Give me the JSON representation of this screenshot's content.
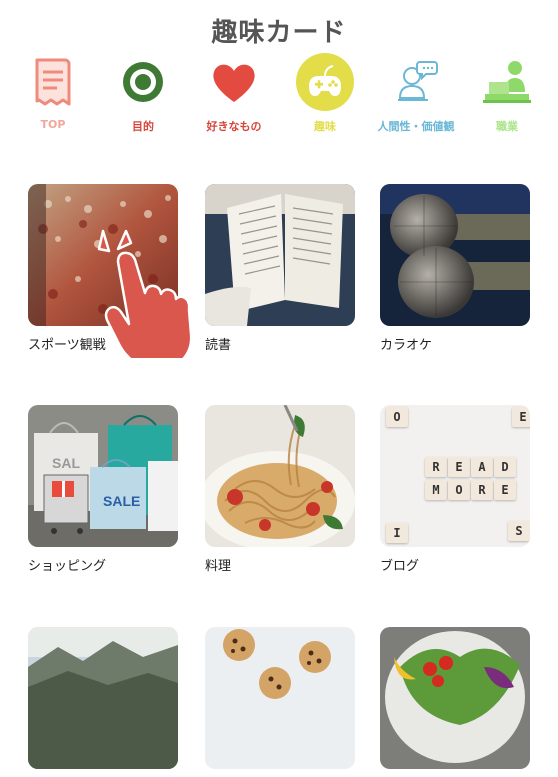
{
  "page_title": "趣味カード",
  "tabs": [
    {
      "label": "TOP",
      "icon": "document-icon",
      "color": "#f4a69a"
    },
    {
      "label": "目的",
      "icon": "target-icon",
      "color": "#d6453a"
    },
    {
      "label": "好きなもの",
      "icon": "heart-icon",
      "color": "#d6453a"
    },
    {
      "label": "趣味",
      "icon": "gamepad-icon",
      "color": "#e2dd49",
      "active": true
    },
    {
      "label": "人間性・価値観",
      "icon": "person-chat-icon",
      "color": "#6ab7d6"
    },
    {
      "label": "職業",
      "icon": "worker-desk-icon",
      "color": "#aee58c"
    }
  ],
  "cards": [
    {
      "label": "スポーツ観戦",
      "image": "stadium-crowd"
    },
    {
      "label": "読書",
      "image": "open-book"
    },
    {
      "label": "カラオケ",
      "image": "microphones"
    },
    {
      "label": "ショッピング",
      "image": "shopping-bags"
    },
    {
      "label": "料理",
      "image": "pasta-dish"
    },
    {
      "label": "ブログ",
      "image": "scrabble-tiles"
    },
    {
      "label": "",
      "image": "mountains"
    },
    {
      "label": "",
      "image": "cookies"
    },
    {
      "label": "",
      "image": "salad"
    }
  ],
  "images_text": {
    "bag_label": "SALE",
    "bag_label_partial": "SAL",
    "tiles_row1": [
      "R",
      "E",
      "A",
      "D"
    ],
    "tiles_row2": [
      "M",
      "O",
      "R",
      "E"
    ],
    "tiles_scattered": [
      "O",
      "E",
      "I",
      "S"
    ]
  }
}
